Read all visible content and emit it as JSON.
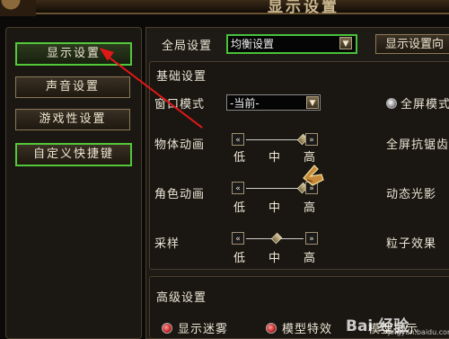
{
  "window": {
    "title": "显示设置"
  },
  "sidebar": {
    "items": [
      {
        "label": "显示设置"
      },
      {
        "label": "声音设置"
      },
      {
        "label": "游戏性设置"
      },
      {
        "label": "自定义快捷键"
      }
    ]
  },
  "header": {
    "global_label": "全局设置",
    "global_value": "均衡设置",
    "tab_label": "显示设置向"
  },
  "basic": {
    "title": "基础设置",
    "window_mode_label": "窗口模式",
    "window_mode_value": "-当前-",
    "fullscreen_label": "全屏模式",
    "object_anim_label": "物体动画",
    "char_anim_label": "角色动画",
    "sampling_label": "采样",
    "fs_aa_label": "全屏抗锯齿",
    "dynamic_light_label": "动态光影",
    "particle_label": "粒子效果",
    "tick_low": "低",
    "tick_mid": "中",
    "tick_high": "高"
  },
  "sliders": {
    "object_anim": {
      "level": 2,
      "max": 2
    },
    "char_anim": {
      "level": 2,
      "max": 2
    },
    "sampling": {
      "level": 1,
      "max": 2
    }
  },
  "advanced": {
    "title": "高级设置",
    "fog_label": "显示迷雾",
    "model_fx_label": "模型特效",
    "model_display_label": "模型显示"
  },
  "watermark": {
    "text": "Bai 经验",
    "sub": "jingyan.baidu.com"
  },
  "colors": {
    "accent_green": "#52c83a",
    "arrow_red": "#e01818",
    "panel_bg": "#1e1a15"
  }
}
